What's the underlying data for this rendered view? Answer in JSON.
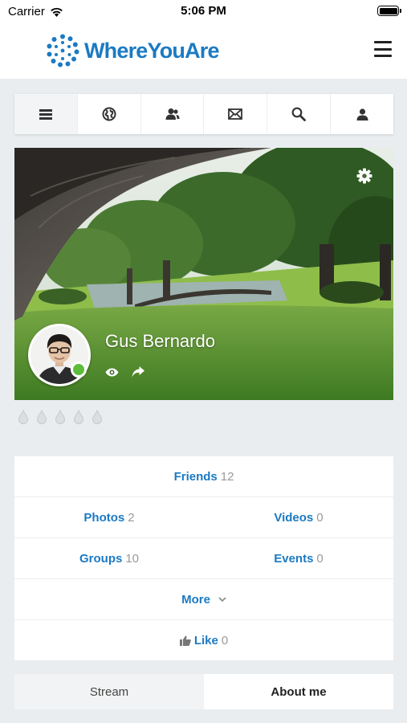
{
  "status_bar": {
    "carrier": "Carrier",
    "time": "5:06 PM"
  },
  "app": {
    "logo_text": "WhereYouAre",
    "brand_color": "#1b7ac3"
  },
  "nav": {
    "items": [
      {
        "icon": "list-icon"
      },
      {
        "icon": "globe-icon"
      },
      {
        "icon": "friends-icon"
      },
      {
        "icon": "mail-icon"
      },
      {
        "icon": "search-icon"
      },
      {
        "icon": "user-icon"
      }
    ]
  },
  "profile": {
    "name": "Gus Bernardo",
    "online": true,
    "online_color": "#5dbd3a"
  },
  "stats": {
    "friends": {
      "label": "Friends",
      "count": "12"
    },
    "photos": {
      "label": "Photos",
      "count": "2"
    },
    "videos": {
      "label": "Videos",
      "count": "0"
    },
    "groups": {
      "label": "Groups",
      "count": "10"
    },
    "events": {
      "label": "Events",
      "count": "0"
    },
    "more": {
      "label": "More"
    },
    "like": {
      "label": "Like",
      "count": "0"
    }
  },
  "tabs": {
    "stream": "Stream",
    "about": "About me",
    "active": "about"
  }
}
